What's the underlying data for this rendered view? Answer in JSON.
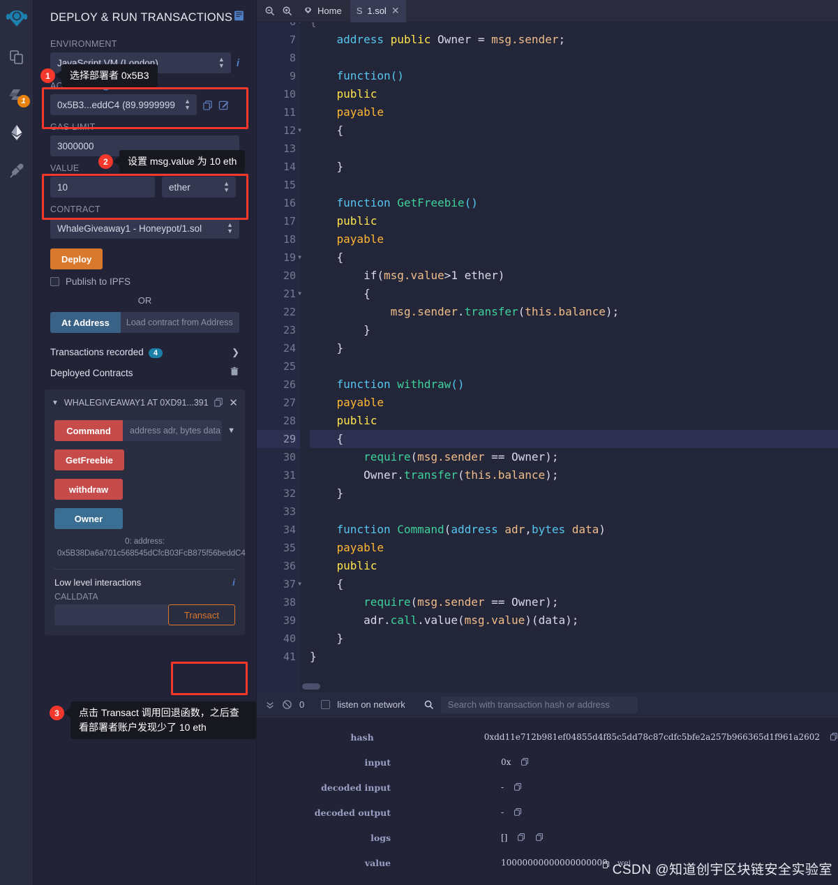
{
  "iconbar": {
    "items": [
      {
        "name": "remix-logo-icon",
        "label": "Remix",
        "badge": ""
      },
      {
        "name": "file-explorer-icon",
        "label": "File explorers",
        "badge": ""
      },
      {
        "name": "solidity-compiler-icon",
        "label": "Solidity compiler",
        "badge": "1"
      },
      {
        "name": "deploy-run-icon",
        "label": "Deploy & run transactions",
        "badge": ""
      },
      {
        "name": "plugin-manager-icon",
        "label": "Plugin manager",
        "badge": ""
      }
    ]
  },
  "sidebar": {
    "title": "DEPLOY & RUN TRANSACTIONS",
    "environment_label": "ENVIRONMENT",
    "environment_value": "JavaScript VM (London)",
    "account_label": "ACCOUNT",
    "account_value": "0x5B3...eddC4 (89.9999999",
    "gas_limit_label": "GAS LIMIT",
    "gas_limit_value": "3000000",
    "value_label": "VALUE",
    "value_amount": "10",
    "value_unit": "ether",
    "contract_label": "CONTRACT",
    "contract_value": "WhaleGiveaway1 - Honeypot/1.sol",
    "deploy_label": "Deploy",
    "publish_ipfs_label": "Publish to IPFS",
    "or_label": "OR",
    "at_address_label": "At Address",
    "at_address_placeholder": "Load contract from Address",
    "transactions_recorded_label": "Transactions recorded",
    "transactions_recorded_count": "4",
    "deployed_contracts_label": "Deployed Contracts",
    "deployed_contract_name": "WHALEGIVEAWAY1 AT 0XD91...391",
    "functions": [
      {
        "label": "Command",
        "placeholder": "address adr, bytes data",
        "kind": "red",
        "has_input": true
      },
      {
        "label": "GetFreebie",
        "placeholder": "",
        "kind": "red",
        "has_input": false
      },
      {
        "label": "withdraw",
        "placeholder": "",
        "kind": "red",
        "has_input": false
      },
      {
        "label": "Owner",
        "placeholder": "",
        "kind": "blue",
        "has_input": false
      }
    ],
    "owner_result": "0:  address: 0x5B38Da6a701c568545dCfcB03FcB875f56beddC4",
    "low_level_label": "Low level interactions",
    "calldata_label": "CALLDATA",
    "transact_label": "Transact"
  },
  "callouts": [
    {
      "num": "1",
      "text": "选择部署者 0x5B3"
    },
    {
      "num": "2",
      "text": "设置 msg.value 为 10 eth"
    },
    {
      "num": "3",
      "text": "点击 Transact 调用回退函数，之后查看部署者账户发现少了 10 eth"
    }
  ],
  "editor": {
    "home_tab": "Home",
    "file_tab": "1.sol",
    "active_line": 29,
    "lines": [
      {
        "n": 6,
        "fold": true,
        "partial": true,
        "tokens": [
          {
            "t": "{",
            "c": "br"
          }
        ]
      },
      {
        "n": 7,
        "fold": false,
        "tokens": [
          {
            "t": "    ",
            "c": "id"
          },
          {
            "t": "address",
            "c": "ty"
          },
          {
            "t": " ",
            "c": "id"
          },
          {
            "t": "public",
            "c": "k"
          },
          {
            "t": " ",
            "c": "id"
          },
          {
            "t": "Owner",
            "c": "id"
          },
          {
            "t": " = ",
            "c": "id"
          },
          {
            "t": "msg.sender",
            "c": "var"
          },
          {
            "t": ";",
            "c": "id"
          }
        ]
      },
      {
        "n": 8,
        "fold": false,
        "tokens": []
      },
      {
        "n": 9,
        "fold": false,
        "tokens": [
          {
            "t": "    ",
            "c": "id"
          },
          {
            "t": "function",
            "c": "ty"
          },
          {
            "t": "()",
            "c": "ty"
          }
        ]
      },
      {
        "n": 10,
        "fold": false,
        "tokens": [
          {
            "t": "    ",
            "c": "id"
          },
          {
            "t": "public",
            "c": "k"
          }
        ]
      },
      {
        "n": 11,
        "fold": false,
        "tokens": [
          {
            "t": "    ",
            "c": "id"
          },
          {
            "t": "payable",
            "c": "k2"
          }
        ]
      },
      {
        "n": 12,
        "fold": true,
        "tokens": [
          {
            "t": "    ",
            "c": "id"
          },
          {
            "t": "{",
            "c": "br"
          }
        ]
      },
      {
        "n": 13,
        "fold": false,
        "tokens": []
      },
      {
        "n": 14,
        "fold": false,
        "tokens": [
          {
            "t": "    ",
            "c": "id"
          },
          {
            "t": "}",
            "c": "br"
          }
        ]
      },
      {
        "n": 15,
        "fold": false,
        "tokens": []
      },
      {
        "n": 16,
        "fold": false,
        "tokens": [
          {
            "t": "    ",
            "c": "id"
          },
          {
            "t": "function",
            "c": "ty"
          },
          {
            "t": " ",
            "c": "id"
          },
          {
            "t": "GetFreebie",
            "c": "fn"
          },
          {
            "t": "()",
            "c": "ty"
          }
        ]
      },
      {
        "n": 17,
        "fold": false,
        "tokens": [
          {
            "t": "    ",
            "c": "id"
          },
          {
            "t": "public",
            "c": "k"
          }
        ]
      },
      {
        "n": 18,
        "fold": false,
        "tokens": [
          {
            "t": "    ",
            "c": "id"
          },
          {
            "t": "payable",
            "c": "k2"
          }
        ]
      },
      {
        "n": 19,
        "fold": true,
        "tokens": [
          {
            "t": "    ",
            "c": "id"
          },
          {
            "t": "{",
            "c": "br"
          }
        ]
      },
      {
        "n": 20,
        "fold": false,
        "tokens": [
          {
            "t": "        ",
            "c": "id"
          },
          {
            "t": "if",
            "c": "id"
          },
          {
            "t": "(",
            "c": "br"
          },
          {
            "t": "msg.value",
            "c": "var"
          },
          {
            "t": ">",
            "c": "id"
          },
          {
            "t": "1",
            "c": "id"
          },
          {
            "t": " ",
            "c": "id"
          },
          {
            "t": "ether",
            "c": "id"
          },
          {
            "t": ")",
            "c": "br"
          }
        ]
      },
      {
        "n": 21,
        "fold": true,
        "tokens": [
          {
            "t": "        ",
            "c": "id"
          },
          {
            "t": "{",
            "c": "br"
          }
        ]
      },
      {
        "n": 22,
        "fold": false,
        "tokens": [
          {
            "t": "            ",
            "c": "id"
          },
          {
            "t": "msg.sender",
            "c": "var"
          },
          {
            "t": ".",
            "c": "id"
          },
          {
            "t": "transfer",
            "c": "fn"
          },
          {
            "t": "(",
            "c": "br"
          },
          {
            "t": "this.balance",
            "c": "var"
          },
          {
            "t": ")",
            "c": "br"
          },
          {
            "t": ";",
            "c": "id"
          }
        ]
      },
      {
        "n": 23,
        "fold": false,
        "tokens": [
          {
            "t": "        ",
            "c": "id"
          },
          {
            "t": "}",
            "c": "br"
          }
        ]
      },
      {
        "n": 24,
        "fold": false,
        "tokens": [
          {
            "t": "    ",
            "c": "id"
          },
          {
            "t": "}",
            "c": "br"
          }
        ]
      },
      {
        "n": 25,
        "fold": false,
        "tokens": []
      },
      {
        "n": 26,
        "fold": false,
        "tokens": [
          {
            "t": "    ",
            "c": "id"
          },
          {
            "t": "function",
            "c": "ty"
          },
          {
            "t": " ",
            "c": "id"
          },
          {
            "t": "withdraw",
            "c": "fn"
          },
          {
            "t": "()",
            "c": "ty"
          }
        ]
      },
      {
        "n": 27,
        "fold": false,
        "tokens": [
          {
            "t": "    ",
            "c": "id"
          },
          {
            "t": "payable",
            "c": "k2"
          }
        ]
      },
      {
        "n": 28,
        "fold": false,
        "tokens": [
          {
            "t": "    ",
            "c": "id"
          },
          {
            "t": "public",
            "c": "k"
          }
        ]
      },
      {
        "n": 29,
        "fold": false,
        "tokens": [
          {
            "t": "    ",
            "c": "id"
          },
          {
            "t": "{",
            "c": "br"
          }
        ]
      },
      {
        "n": 30,
        "fold": false,
        "tokens": [
          {
            "t": "        ",
            "c": "id"
          },
          {
            "t": "require",
            "c": "fn"
          },
          {
            "t": "(",
            "c": "br"
          },
          {
            "t": "msg.sender",
            "c": "var"
          },
          {
            "t": " == ",
            "c": "id"
          },
          {
            "t": "Owner",
            "c": "id"
          },
          {
            "t": ")",
            "c": "br"
          },
          {
            "t": ";",
            "c": "id"
          }
        ]
      },
      {
        "n": 31,
        "fold": false,
        "tokens": [
          {
            "t": "        ",
            "c": "id"
          },
          {
            "t": "Owner",
            "c": "id"
          },
          {
            "t": ".",
            "c": "id"
          },
          {
            "t": "transfer",
            "c": "fn"
          },
          {
            "t": "(",
            "c": "br"
          },
          {
            "t": "this.balance",
            "c": "var"
          },
          {
            "t": ")",
            "c": "br"
          },
          {
            "t": ";",
            "c": "id"
          }
        ]
      },
      {
        "n": 32,
        "fold": false,
        "tokens": [
          {
            "t": "    ",
            "c": "id"
          },
          {
            "t": "}",
            "c": "br"
          }
        ]
      },
      {
        "n": 33,
        "fold": false,
        "tokens": []
      },
      {
        "n": 34,
        "fold": false,
        "tokens": [
          {
            "t": "    ",
            "c": "id"
          },
          {
            "t": "function",
            "c": "ty"
          },
          {
            "t": " ",
            "c": "id"
          },
          {
            "t": "Command",
            "c": "fn"
          },
          {
            "t": "(",
            "c": "br"
          },
          {
            "t": "address",
            "c": "ty"
          },
          {
            "t": " ",
            "c": "id"
          },
          {
            "t": "adr",
            "c": "var"
          },
          {
            "t": ",",
            "c": "id"
          },
          {
            "t": "bytes",
            "c": "ty"
          },
          {
            "t": " ",
            "c": "id"
          },
          {
            "t": "data",
            "c": "var"
          },
          {
            "t": ")",
            "c": "br"
          }
        ]
      },
      {
        "n": 35,
        "fold": false,
        "tokens": [
          {
            "t": "    ",
            "c": "id"
          },
          {
            "t": "payable",
            "c": "k2"
          }
        ]
      },
      {
        "n": 36,
        "fold": false,
        "tokens": [
          {
            "t": "    ",
            "c": "id"
          },
          {
            "t": "public",
            "c": "k"
          }
        ]
      },
      {
        "n": 37,
        "fold": true,
        "tokens": [
          {
            "t": "    ",
            "c": "id"
          },
          {
            "t": "{",
            "c": "br"
          }
        ]
      },
      {
        "n": 38,
        "fold": false,
        "tokens": [
          {
            "t": "        ",
            "c": "id"
          },
          {
            "t": "require",
            "c": "fn"
          },
          {
            "t": "(",
            "c": "br"
          },
          {
            "t": "msg.sender",
            "c": "var"
          },
          {
            "t": " == ",
            "c": "id"
          },
          {
            "t": "Owner",
            "c": "id"
          },
          {
            "t": ")",
            "c": "br"
          },
          {
            "t": ";",
            "c": "id"
          }
        ]
      },
      {
        "n": 39,
        "fold": false,
        "tokens": [
          {
            "t": "        ",
            "c": "id"
          },
          {
            "t": "adr",
            "c": "id"
          },
          {
            "t": ".",
            "c": "id"
          },
          {
            "t": "call",
            "c": "fn"
          },
          {
            "t": ".",
            "c": "id"
          },
          {
            "t": "value",
            "c": "id"
          },
          {
            "t": "(",
            "c": "br"
          },
          {
            "t": "msg.value",
            "c": "var"
          },
          {
            "t": ")(",
            "c": "br"
          },
          {
            "t": "data",
            "c": "id"
          },
          {
            "t": ")",
            "c": "br"
          },
          {
            "t": ";",
            "c": "id"
          }
        ]
      },
      {
        "n": 40,
        "fold": false,
        "tokens": [
          {
            "t": "    ",
            "c": "id"
          },
          {
            "t": "}",
            "c": "br"
          }
        ]
      },
      {
        "n": 41,
        "fold": false,
        "tokens": [
          {
            "t": "}",
            "c": "br"
          }
        ]
      }
    ]
  },
  "terminal": {
    "pending_count": "0",
    "listen_label": "listen on network",
    "search_placeholder": "Search with transaction hash or address",
    "rows": [
      {
        "key": "hash",
        "value": "0xdd11e712b981ef04855d4f85c5dd78c87cdfc5bfe2a257b966365d1f961a2602",
        "unit": "",
        "copies": 1
      },
      {
        "key": "input",
        "value": "0x",
        "unit": "",
        "copies": 1
      },
      {
        "key": "decoded input",
        "value": "-",
        "unit": "",
        "copies": 1
      },
      {
        "key": "decoded output",
        "value": "-",
        "unit": "",
        "copies": 1
      },
      {
        "key": "logs",
        "value": "[]",
        "unit": "",
        "copies": 2
      },
      {
        "key": "value",
        "value": "10000000000000000000",
        "unit": "wei",
        "copies": 0
      }
    ]
  },
  "watermark": "CSDN @知道创宇区块链安全实验室",
  "colors": {
    "accent_orange": "#d9792e",
    "highlight_red": "#f5382c",
    "badge_blue": "#1b7fa8",
    "fn_red": "#c64b4b",
    "fn_blue": "#3a6e93"
  }
}
